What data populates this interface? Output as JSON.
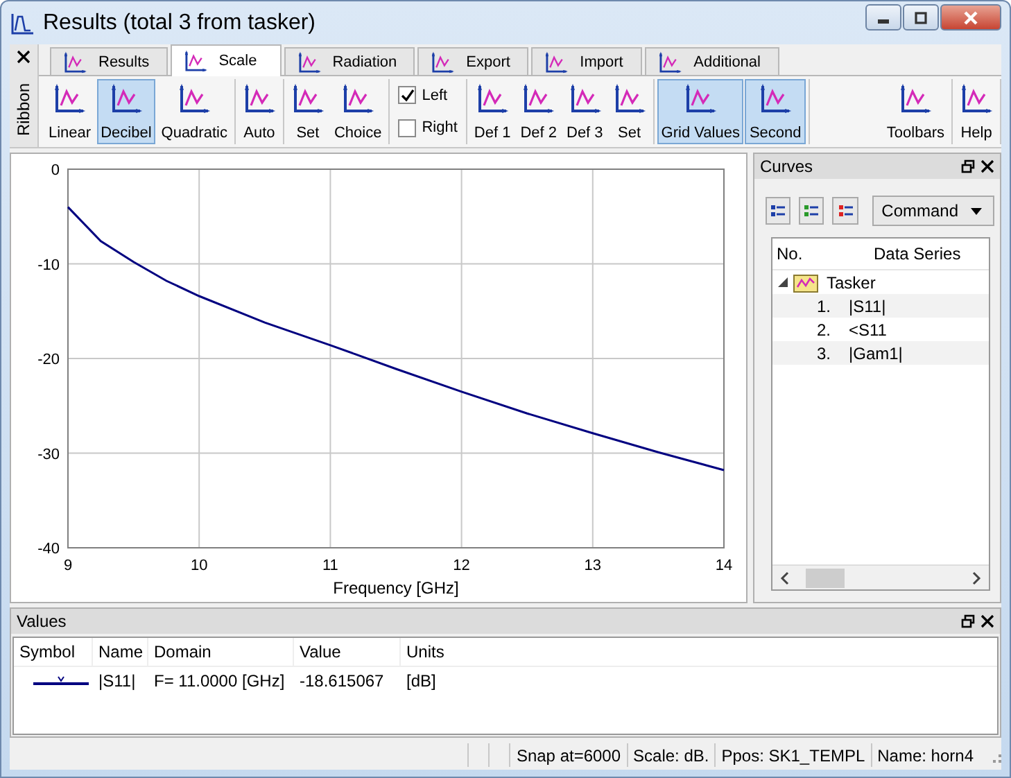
{
  "window": {
    "title": "Results (total 3 from tasker)"
  },
  "ribbon": {
    "label": "Ribbon",
    "tabs": [
      {
        "label": "Results",
        "selected": false
      },
      {
        "label": "Scale",
        "selected": true
      },
      {
        "label": "Radiation",
        "selected": false
      },
      {
        "label": "Export",
        "selected": false
      },
      {
        "label": "Import",
        "selected": false
      },
      {
        "label": "Additional",
        "selected": false
      }
    ],
    "groups": [
      [
        {
          "kind": "button",
          "label": "Linear",
          "pressed": false
        },
        {
          "kind": "button",
          "label": "Decibel",
          "pressed": true
        },
        {
          "kind": "button",
          "label": "Quadratic",
          "pressed": false
        }
      ],
      [
        {
          "kind": "button",
          "label": "Auto",
          "pressed": false
        }
      ],
      [
        {
          "kind": "button",
          "label": "Set",
          "pressed": false
        },
        {
          "kind": "button",
          "label": "Choice",
          "pressed": false
        }
      ],
      [
        {
          "kind": "checkbox",
          "label": "Left",
          "checked": true
        },
        {
          "kind": "checkbox",
          "label": "Right",
          "checked": false
        }
      ],
      [
        {
          "kind": "button",
          "label": "Def 1",
          "pressed": false
        },
        {
          "kind": "button",
          "label": "Def 2",
          "pressed": false
        },
        {
          "kind": "button",
          "label": "Def 3",
          "pressed": false
        },
        {
          "kind": "button",
          "label": "Set",
          "pressed": false
        }
      ],
      [
        {
          "kind": "button",
          "label": "Grid Values",
          "pressed": true
        },
        {
          "kind": "button",
          "label": "Second",
          "pressed": true
        }
      ]
    ],
    "right_groups": [
      [
        {
          "kind": "button",
          "label": "Toolbars",
          "pressed": false
        }
      ],
      [
        {
          "kind": "button",
          "label": "Help",
          "pressed": false
        }
      ]
    ]
  },
  "chart_data": {
    "type": "line",
    "xlabel": "Frequency [GHz]",
    "x": [
      9,
      9.25,
      9.5,
      9.75,
      10,
      10.5,
      11,
      11.5,
      12,
      12.5,
      13,
      13.5,
      14
    ],
    "series": [
      {
        "color": "#000080",
        "values": [
          -4,
          -7.6,
          -9.8,
          -11.8,
          -13.4,
          -16.2,
          -18.6,
          -21.1,
          -23.5,
          -25.8,
          -27.9,
          -29.9,
          -31.8
        ]
      }
    ],
    "xlim": [
      9,
      14
    ],
    "ylim": [
      -40,
      0
    ],
    "xticks": [
      9,
      10,
      11,
      12,
      13,
      14
    ],
    "yticks": [
      -40,
      -30,
      -20,
      -10,
      0
    ],
    "grid": true
  },
  "curves": {
    "title": "Curves",
    "command": "Command",
    "columns": [
      "No.",
      "Data Series"
    ],
    "tree": [
      {
        "label": "Tasker",
        "expanded": true,
        "children": [
          {
            "no": "1.",
            "series": "|S11|"
          },
          {
            "no": "2.",
            "series": "<S11"
          },
          {
            "no": "3.",
            "series": "|Gam1|"
          }
        ]
      }
    ]
  },
  "values": {
    "title": "Values",
    "columns": [
      "Symbol",
      "Name",
      "Domain",
      "Value",
      "Units"
    ],
    "rows": [
      {
        "color": "#000080",
        "name": "|S11|",
        "domain": "F= 11.0000 [GHz]",
        "value": "-18.615067",
        "units": "[dB]"
      }
    ]
  },
  "status_bar": [
    "Snap at=6000",
    "Scale: dB.",
    "Ppos: SK1_TEMPL",
    "Name: horn4"
  ]
}
